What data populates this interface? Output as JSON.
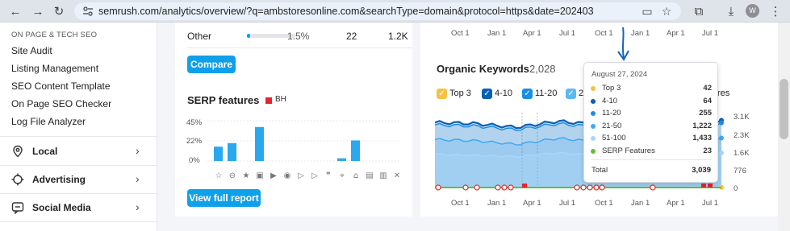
{
  "browser": {
    "url": "semrush.com/analytics/overview/?q=ambstoresonline.com&searchType=domain&protocol=https&date=202403",
    "profile_initial": "W"
  },
  "sidebar": {
    "heading": "ON PAGE & TECH SEO",
    "items": [
      {
        "label": "Site Audit"
      },
      {
        "label": "Listing Management"
      },
      {
        "label": "SEO Content Template"
      },
      {
        "label": "On Page SEO Checker"
      },
      {
        "label": "Log File Analyzer"
      }
    ],
    "sections": [
      {
        "label": "Local",
        "icon": "location-pin-icon"
      },
      {
        "label": "Advertising",
        "icon": "crosshair-icon"
      },
      {
        "label": "Social Media",
        "icon": "chat-bubble-icon"
      }
    ]
  },
  "left_panel": {
    "other_row": {
      "label": "Other",
      "percent": "1.5%",
      "count": "22",
      "traffic": "1.2K",
      "bar_fill": 0.015
    },
    "compare_label": "Compare",
    "serp_title": "SERP features",
    "serp_legend": "BH",
    "view_full_report_label": "View full report",
    "serp_chart": {
      "type": "bar",
      "y_ticks": [
        "45%",
        "22%",
        "0%"
      ],
      "ylim": [
        0,
        45
      ],
      "values": [
        16,
        20,
        0,
        38,
        0,
        0,
        0,
        0,
        0,
        0,
        3,
        23,
        0,
        0,
        0,
        0,
        0
      ],
      "icons": [
        "star-outline-icon",
        "link-icon",
        "star-icon",
        "image-icon",
        "video-play-icon",
        "video-icon",
        "play-box-icon",
        "play-box-icon",
        "quote-icon",
        "map-pin-icon",
        "graduation-cap-icon",
        "document-icon",
        "briefcase-icon",
        "x-logo-icon"
      ]
    }
  },
  "right_panel": {
    "top_axis": [
      "Oct 1",
      "Jan 1",
      "Apr 1",
      "Jul 1",
      "Oct 1",
      "Jan 1",
      "Apr 1",
      "Jul 1"
    ],
    "title": "Organic Keywords",
    "count": "2,028",
    "checkboxes": [
      {
        "label": "Top 3",
        "color": "#f5c242"
      },
      {
        "label": "4-10",
        "color": "#0a5fb4"
      },
      {
        "label": "11-20",
        "color": "#1a8ee6"
      },
      {
        "label": "2",
        "color": "#5db8f2"
      }
    ],
    "cut_off_label": "res",
    "y_ticks": [
      "3.1K",
      "2.3K",
      "1.6K",
      "776",
      "0"
    ],
    "bottom_axis": [
      "Oct 1",
      "Jan 1",
      "Apr 1",
      "Jul 1",
      "Oct 1",
      "Jan 1",
      "Apr 1",
      "Jul 1"
    ],
    "tooltip": {
      "date": "August 27, 2024",
      "rows": [
        {
          "label": "Top 3",
          "value": "42",
          "color": "#f5c242"
        },
        {
          "label": "4-10",
          "value": "64",
          "color": "#0a5fb4"
        },
        {
          "label": "11-20",
          "value": "255",
          "color": "#1a8ee6"
        },
        {
          "label": "21-50",
          "value": "1,222",
          "color": "#3fa9f5"
        },
        {
          "label": "51-100",
          "value": "1,433",
          "color": "#a8d6fa"
        },
        {
          "label": "SERP Features",
          "value": "23",
          "color": "#5fbf3a"
        }
      ],
      "total_label": "Total",
      "total_value": "3,039"
    }
  },
  "chart_data": [
    {
      "type": "bar",
      "title": "SERP features",
      "categories": [
        "1",
        "2",
        "3",
        "4",
        "5",
        "6",
        "7",
        "8",
        "9",
        "10",
        "11",
        "12",
        "13",
        "14"
      ],
      "series": [
        {
          "name": "BH",
          "values": [
            16,
            20,
            0,
            38,
            0,
            0,
            0,
            0,
            0,
            3,
            23,
            0,
            0,
            0
          ]
        }
      ],
      "ylim": [
        0,
        45
      ],
      "y_ticks": [
        "45%",
        "22%",
        "0%"
      ]
    },
    {
      "type": "area",
      "title": "Organic Keywords",
      "x": [
        "Oct 1",
        "Jan 1",
        "Apr 1",
        "Jul 1",
        "Oct 1",
        "Jan 1",
        "Apr 1",
        "Jul 1"
      ],
      "ylim": [
        0,
        3100
      ],
      "y_ticks": [
        "3.1K",
        "2.3K",
        "1.6K",
        "776",
        "0"
      ],
      "series": [
        {
          "name": "Top 3",
          "values": [
            45,
            42,
            40,
            44,
            42,
            41,
            42,
            42
          ]
        },
        {
          "name": "4-10",
          "values": [
            2700,
            2650,
            2500,
            2750,
            2600,
            2700,
            2650,
            2720
          ]
        },
        {
          "name": "11-20",
          "values": [
            2600,
            2550,
            2400,
            2650,
            2500,
            2600,
            2550,
            2620
          ]
        },
        {
          "name": "21-50",
          "values": [
            2000,
            1950,
            1800,
            2050,
            1900,
            2000,
            1950,
            2010
          ]
        },
        {
          "name": "51-100",
          "values": [
            1400,
            1350,
            1300,
            1450,
            1350,
            1400,
            1380,
            1420
          ]
        }
      ]
    }
  ]
}
